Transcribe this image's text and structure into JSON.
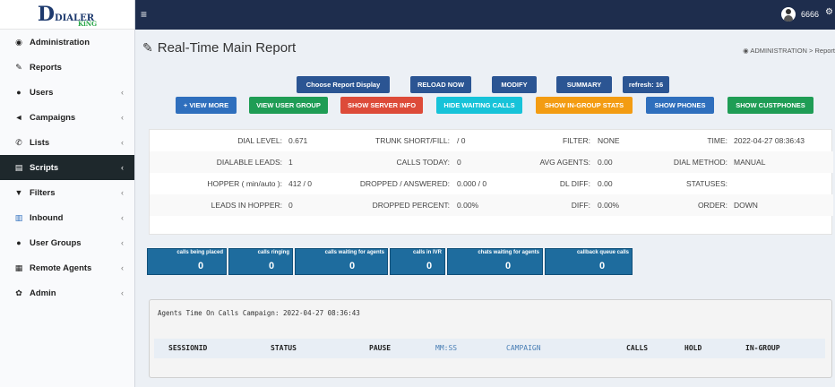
{
  "logo": {
    "main": "DIALER",
    "sub": "KiNG"
  },
  "sidebar": {
    "items": [
      {
        "label": "Administration",
        "icon": "dashboard-icon",
        "chevron": ""
      },
      {
        "label": "Reports",
        "icon": "edit-icon",
        "chevron": ""
      },
      {
        "label": "Users",
        "icon": "user-icon",
        "chevron": "‹"
      },
      {
        "label": "Campaigns",
        "icon": "bullhorn-icon",
        "chevron": "‹"
      },
      {
        "label": "Lists",
        "icon": "phone-icon",
        "chevron": "‹"
      },
      {
        "label": "Scripts",
        "icon": "file-icon",
        "chevron": "‹"
      },
      {
        "label": "Filters",
        "icon": "filter-icon",
        "chevron": "‹"
      },
      {
        "label": "Inbound",
        "icon": "bar-chart-icon",
        "chevron": "‹"
      },
      {
        "label": "User Groups",
        "icon": "users-icon",
        "chevron": "‹"
      },
      {
        "label": "Remote Agents",
        "icon": "building-icon",
        "chevron": "‹"
      },
      {
        "label": "Admin",
        "icon": "gear-icon",
        "chevron": "‹"
      }
    ],
    "active_item": "Scripts"
  },
  "header": {
    "hamburger": "≡",
    "user_name": "6666",
    "cog": "⚙"
  },
  "page": {
    "title": "Real-Time Main Report",
    "breadcrumb": "ADMINISTRATION  >  Report"
  },
  "buttons": {
    "choose_display": "Choose Report Display",
    "reload": "RELOAD NOW",
    "modify": "MODIFY",
    "summary": "SUMMARY",
    "refresh": "refresh: 16",
    "view_more": "+ VIEW MORE",
    "view_user_group": "VIEW USER GROUP",
    "show_server_info": "SHOW SERVER INFO",
    "hide_waiting_calls": "HIDE WAITING CALLS",
    "show_ingroup_stats": "SHOW IN-GROUP STATS",
    "show_phones": "SHOW PHONES",
    "show_custphones": "SHOW CUSTPHONES"
  },
  "colors": {
    "navy": "#2b5593",
    "green": "#1f9d55",
    "red": "#dd4b39",
    "cyan": "#17c3d9",
    "orange": "#f39c12",
    "blue": "#2f6fbd",
    "tile": "#1e6c9e"
  },
  "stats": {
    "dial_level_label": "DIAL LEVEL:",
    "dial_level": "0.671",
    "trunk_label": "TRUNK SHORT/FILL:",
    "trunk": "/ 0",
    "filter_label": "FILTER:",
    "filter": "NONE",
    "time_label": "TIME:",
    "time": "2022-04-27 08:36:43",
    "dialable_label": "DIALABLE LEADS:",
    "dialable": "1",
    "calls_today_label": "CALLS TODAY:",
    "calls_today": "0",
    "avg_agents_label": "AVG AGENTS:",
    "avg_agents": "0.00",
    "dial_method_label": "DIAL METHOD:",
    "dial_method": "MANUAL",
    "hopper_label": "HOPPER ( min/auto ):",
    "hopper": "412 / 0",
    "dropped_answered_label": "DROPPED / ANSWERED:",
    "dropped_answered": "0.000 / 0",
    "dl_diff_label": "DL DIFF:",
    "dl_diff": "0.00",
    "statuses_label": "STATUSES:",
    "statuses": "",
    "leads_hopper_label": "LEADS IN HOPPER:",
    "leads_hopper": "0",
    "dropped_percent_label": "DROPPED PERCENT:",
    "dropped_percent": "0.00%",
    "diff_label": "DIFF:",
    "diff": "0.00%",
    "order_label": "ORDER:",
    "order": "DOWN"
  },
  "tiles": [
    {
      "label": "calls being placed",
      "value": "0"
    },
    {
      "label": "calls ringing",
      "value": "0"
    },
    {
      "label": "calls waiting for agents",
      "value": "0"
    },
    {
      "label": "calls in IVR",
      "value": "0"
    },
    {
      "label": "chats waiting for agents",
      "value": "0"
    },
    {
      "label": "callback queue calls",
      "value": "0"
    }
  ],
  "agents": {
    "heading": "Agents Time On Calls Campaign: 2022-04-27 08:36:43",
    "columns": [
      "SESSIONID",
      "STATUS",
      "PAUSE",
      "MM:SS",
      "CAMPAIGN",
      "CALLS",
      "HOLD",
      "IN-GROUP"
    ]
  }
}
